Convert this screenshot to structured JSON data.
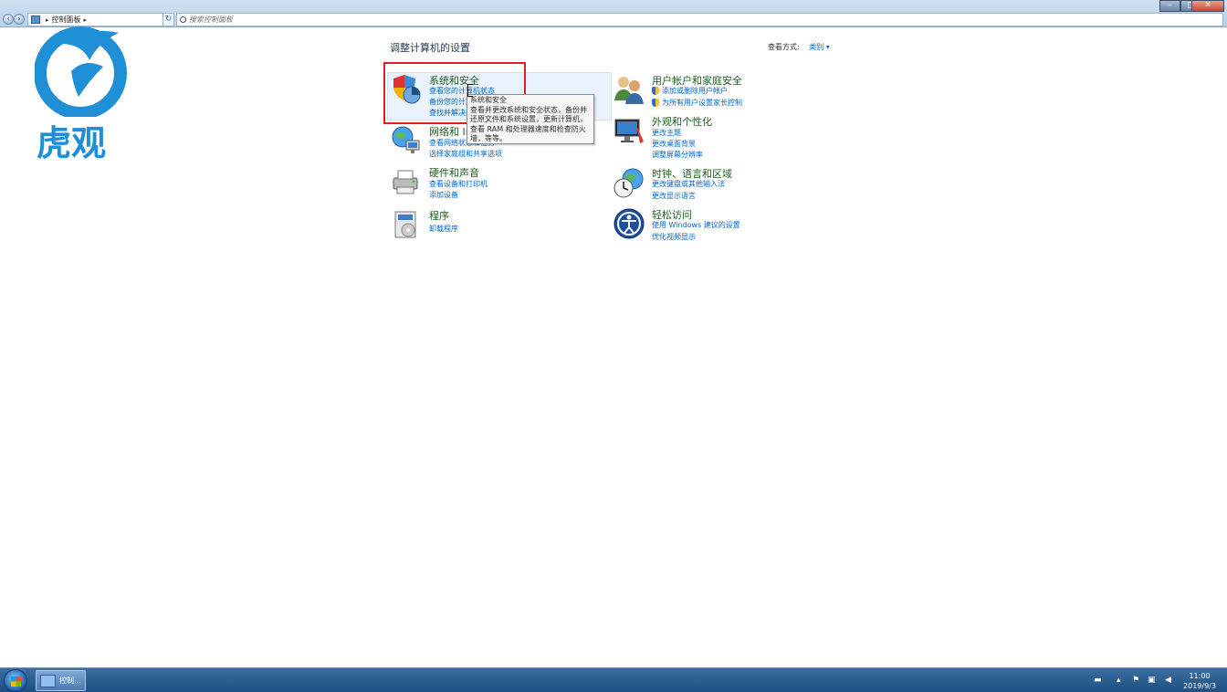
{
  "window": {
    "breadcrumb": "控制面板",
    "search_placeholder": "搜索控制面板",
    "controls": {
      "minimize": "–",
      "maximize": "□",
      "close": "✕"
    }
  },
  "logo": {
    "text": "虎观"
  },
  "main": {
    "heading": "调整计算机的设置",
    "view_by_label": "查看方式:",
    "view_by_value": "类别",
    "categories": [
      {
        "title": "系统和安全",
        "icon": "system-security-icon",
        "links": [
          "查看您的计算机状态",
          "备份您的计算机",
          "查找并解决问题"
        ]
      },
      {
        "title": "网络和 Internet",
        "icon": "network-icon",
        "links": [
          "查看网络状态和任务",
          "选择家庭组和共享选项"
        ]
      },
      {
        "title": "硬件和声音",
        "icon": "hardware-sound-icon",
        "links": [
          "查看设备和打印机",
          "添加设备"
        ]
      },
      {
        "title": "程序",
        "icon": "programs-icon",
        "links": [
          "卸载程序"
        ]
      },
      {
        "title": "用户帐户和家庭安全",
        "icon": "user-accounts-icon",
        "links": [
          "添加或删除用户帐户",
          "为所有用户设置家长控制"
        ]
      },
      {
        "title": "外观和个性化",
        "icon": "appearance-icon",
        "links": [
          "更改主题",
          "更改桌面背景",
          "调整屏幕分辨率"
        ]
      },
      {
        "title": "时钟、语言和区域",
        "icon": "clock-language-icon",
        "links": [
          "更改键盘或其他输入法",
          "更改显示语言"
        ]
      },
      {
        "title": "轻松访问",
        "icon": "ease-of-access-icon",
        "links": [
          "使用 Windows 建议的设置",
          "优化视频显示"
        ]
      }
    ],
    "tooltip": {
      "line1": "系统和安全",
      "line2": "查看并更改系统和安全状态，备份并",
      "line3": "还原文件和系统设置，更新计算机，",
      "line4": "查看 RAM 和处理器速度和检查防火",
      "line5": "墙，等等。"
    }
  },
  "taskbar": {
    "app_label": "控制...",
    "time": "11:00",
    "date": "2019/9/3"
  }
}
